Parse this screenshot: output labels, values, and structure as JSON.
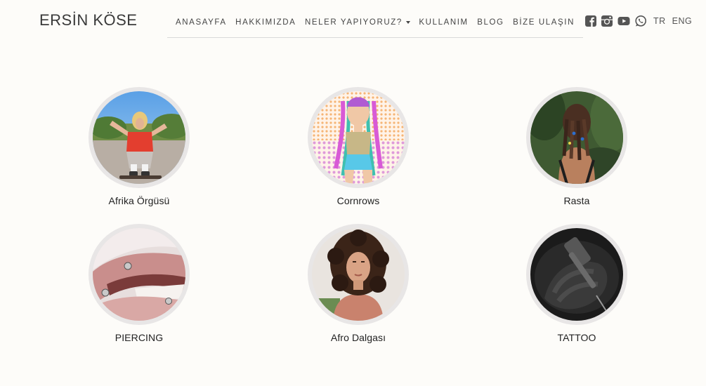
{
  "header": {
    "logo": "ERSİN KÖSE",
    "nav": [
      {
        "label": "ANASAYFA"
      },
      {
        "label": "HAKKIMIZDA"
      },
      {
        "label": "NELER YAPIYORUZ?"
      },
      {
        "label": "KULLANIM"
      },
      {
        "label": "BLOG"
      },
      {
        "label": "BİZE ULAŞIN"
      }
    ],
    "social_icons": [
      "facebook-icon",
      "instagram-icon",
      "youtube-icon",
      "whatsapp-icon"
    ],
    "languages": [
      "TR",
      "ENG"
    ]
  },
  "services": [
    {
      "label": "Afrika Örgüsü",
      "image": "afrika-orgusu-image"
    },
    {
      "label": "Cornrows",
      "image": "cornrows-image"
    },
    {
      "label": "Rasta",
      "image": "rasta-image"
    },
    {
      "label": "PIERCING",
      "image": "piercing-image"
    },
    {
      "label": "Afro Dalgası",
      "image": "afro-dalgasi-image"
    },
    {
      "label": "TATTOO",
      "image": "tattoo-image"
    }
  ],
  "colors": {
    "background": "#fdfcf9",
    "text": "#333333",
    "circle_ring": "#e8e6e6",
    "nav_divider": "#d9d9d9"
  }
}
